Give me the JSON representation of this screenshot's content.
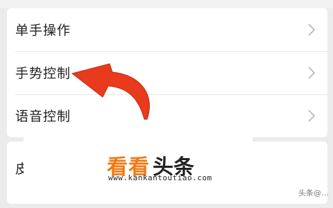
{
  "settings": {
    "items": [
      {
        "label": "单手操作",
        "icon": "chevron-right-icon"
      },
      {
        "label": "手势控制",
        "icon": "chevron-right-icon"
      },
      {
        "label": "语音控制",
        "icon": "chevron-right-icon"
      }
    ],
    "partial_item_label": "皮",
    "partial_bottom_label": " "
  },
  "overlay": {
    "arrow_icon": "curved-arrow-icon",
    "arrow_color": "#e83a1c"
  },
  "watermark": {
    "title_orange": "看看",
    "title_dark": "头条",
    "url": "www.kankantoutiao.com",
    "color": "#f07a12"
  },
  "credit": {
    "text": "头条@…"
  },
  "colors": {
    "background": "#ebebeb",
    "card": "#ffffff",
    "text": "#222222",
    "chevron": "#b8b8b8"
  }
}
